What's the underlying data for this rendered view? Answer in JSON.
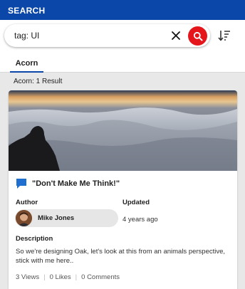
{
  "header": {
    "title": "SEARCH"
  },
  "search": {
    "query": "tag: UI"
  },
  "tabs": [
    {
      "label": "Acorn",
      "active": true
    }
  ],
  "results": {
    "summary": "Acorn: 1 Result"
  },
  "card": {
    "title": "\"Don't Make Me Think!\"",
    "author_label": "Author",
    "author_name": "Mike Jones",
    "updated_label": "Updated",
    "updated_value": "4 years ago",
    "description_label": "Description",
    "description": "So we're designing Oak, let's look at this from an animals perspective, stick with me here..",
    "stats": {
      "views": "3 Views",
      "likes": "0 Likes",
      "comments": "0 Comments"
    }
  },
  "icons": {
    "clear": "close-icon",
    "search": "search-icon",
    "sort": "sort-icon",
    "card_type": "chat-bubble-icon"
  },
  "colors": {
    "header_bg": "#0a47a9",
    "search_button": "#e5161b",
    "tab_underline": "#0a47a9",
    "card_icon": "#1f6fd0"
  }
}
